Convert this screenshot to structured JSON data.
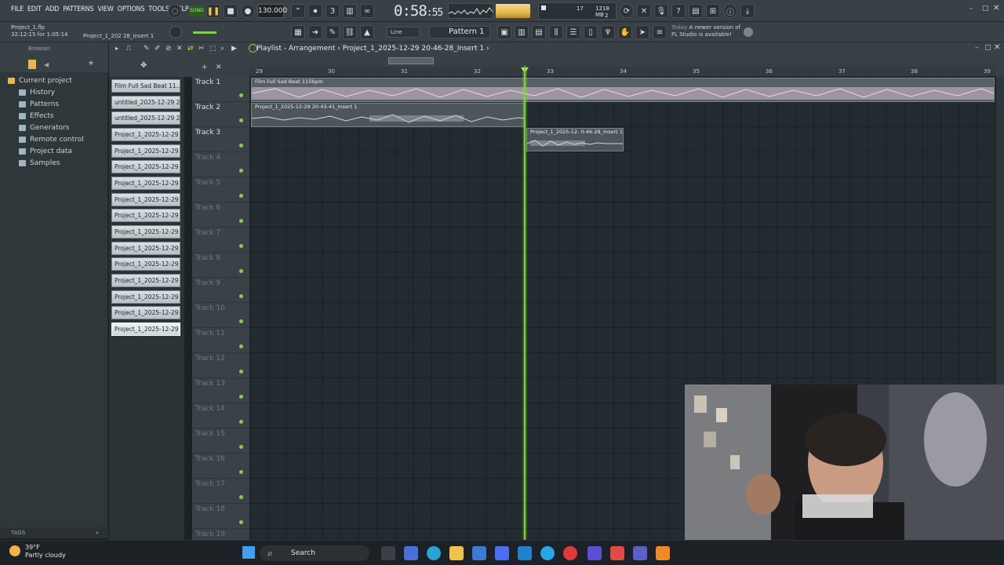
{
  "app": {
    "menu": [
      "FILE",
      "EDIT",
      "ADD",
      "PATTERNS",
      "VIEW",
      "OPTIONS",
      "TOOLS",
      "HELP"
    ],
    "song_mode": "SONG",
    "tempo": "130.000",
    "time_main": "0:58",
    "time_sub": ":55",
    "cpu_a": "17",
    "cpu_b": "1218 MB",
    "cpu_c": "2",
    "project_file": "Project_1.flp",
    "time_hint": "32:12:15 for 1:05:14",
    "insert_hint": "Project_1_202 28_Insert 1",
    "snap": "Line",
    "pattern": "Pattern 1",
    "update_today": "Today",
    "update_text": "A newer version of",
    "update_text2": "FL Studio is available!"
  },
  "browser": {
    "label": "Browser",
    "items": [
      {
        "label": "Current project",
        "icon": "folder-icon",
        "color": "#e6b94a"
      },
      {
        "label": "History",
        "icon": "history-icon",
        "color": "#9fb5c0"
      },
      {
        "label": "Patterns",
        "icon": "patterns-icon",
        "color": "#9fb5c0"
      },
      {
        "label": "Effects",
        "icon": "effects-icon",
        "color": "#9fb5c0"
      },
      {
        "label": "Generators",
        "icon": "generators-icon",
        "color": "#9fb5c0"
      },
      {
        "label": "Remote control",
        "icon": "remote-icon",
        "color": "#9fb5c0"
      },
      {
        "label": "Project data",
        "icon": "data-icon",
        "color": "#9fb5c0"
      },
      {
        "label": "Samples",
        "icon": "samples-icon",
        "color": "#9fb5c0"
      }
    ],
    "tags": "TAGS"
  },
  "picker": [
    "Film Full Sad Beat 11...",
    "untitled_2025-12-29 20-...",
    "untitled_2025-12-29 20-...",
    "Project_1_2025-12-29 2...",
    "Project_1_2025-12-29 2...",
    "Project_1_2025-12-29 2...",
    "Project_1_2025-12-29 2...",
    "Project_1_2025-12-29 2...",
    "Project_1_2025-12-29 2...",
    "Project_1_2025-12-29 2...",
    "Project_1_2025-12-29 2...",
    "Project_1_2025-12-29 2...",
    "Project_1_2025-12-29 2...",
    "Project_1_2025-12-29 2...",
    "Project_1_2025-12-29 2..."
  ],
  "playlist": {
    "title": "Playlist - Arrangement",
    "breadcrumb": "Project_1_2025-12-29 20-46-28_Insert 1",
    "ruler": [
      "29",
      "30",
      "31",
      "32",
      "33",
      "34",
      "35",
      "36",
      "37",
      "38",
      "39"
    ],
    "tracks": [
      "Track 1",
      "Track 2",
      "Track 3",
      "Track 4",
      "Track 5",
      "Track 6",
      "Track 7",
      "Track 8",
      "Track 9",
      "Track 10",
      "Track 11",
      "Track 12",
      "Track 13",
      "Track 14",
      "Track 15",
      "Track 16",
      "Track 17",
      "Track 18",
      "Track 19"
    ],
    "clips": [
      {
        "label": "Film Full Sad Beat 115bpm"
      },
      {
        "label": "Project_1_2025-12-29 20-43-41_Insert 1"
      },
      {
        "label": "Project_1_2025-12- 0-46-28_Insert 1"
      }
    ]
  },
  "taskbar": {
    "temp": "39°F",
    "weather": "Partly cloudy",
    "search": "Search"
  }
}
